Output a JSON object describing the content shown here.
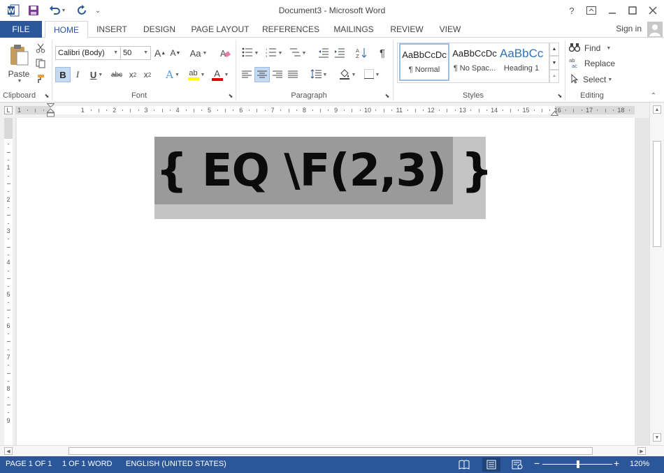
{
  "window": {
    "title": "Document3 - Microsoft Word",
    "help_label": "?"
  },
  "tabs": [
    {
      "label": "FILE"
    },
    {
      "label": "HOME"
    },
    {
      "label": "INSERT"
    },
    {
      "label": "DESIGN"
    },
    {
      "label": "PAGE LAYOUT"
    },
    {
      "label": "REFERENCES"
    },
    {
      "label": "MAILINGS"
    },
    {
      "label": "REVIEW"
    },
    {
      "label": "VIEW"
    }
  ],
  "account": {
    "signin_label": "Sign in"
  },
  "clipboard": {
    "paste_label": "Paste",
    "group_label": "Clipboard"
  },
  "font": {
    "family_value": "Calibri (Body)",
    "size_value": "50",
    "grow_label": "A",
    "shrink_label": "A",
    "case_label": "Aa",
    "bold_label": "B",
    "italic_label": "I",
    "underline_label": "U",
    "strike_label": "abc",
    "subscript_label": "x",
    "subscript_sub": "2",
    "superscript_label": "x",
    "superscript_sup": "2",
    "effects_label": "A",
    "highlight_label": "ab",
    "color_label": "A",
    "group_label": "Font",
    "colors": {
      "highlight": "#ffff00",
      "font_color": "#e00000"
    }
  },
  "paragraph": {
    "group_label": "Paragraph",
    "pilcrow_label": "¶"
  },
  "styles": {
    "items": [
      {
        "sample": "AaBbCcDc",
        "name": "¶ Normal"
      },
      {
        "sample": "AaBbCcDc",
        "name": "¶ No Spac..."
      },
      {
        "sample": "AaBbCc",
        "name": "Heading 1"
      }
    ],
    "group_label": "Styles",
    "heading_color": "#2e74b5"
  },
  "editing": {
    "find_label": "Find",
    "replace_label": "Replace",
    "select_label": "Select",
    "group_label": "Editing"
  },
  "ruler": {
    "tab_selector_label": "L",
    "ticks": [
      "1",
      "1",
      "2",
      "3",
      "4",
      "5",
      "6",
      "7",
      "8",
      "9",
      "10",
      "11",
      "12",
      "13",
      "14",
      "15",
      "16",
      "17",
      "18"
    ],
    "vticks": [
      "1",
      "2",
      "3",
      "4",
      "5",
      "6",
      "7",
      "8",
      "9"
    ]
  },
  "document": {
    "field_code": "{ EQ \\F(2,3) }"
  },
  "status": {
    "page": "PAGE 1 OF 1",
    "words": "1 OF 1 WORD",
    "language": "ENGLISH (UNITED STATES)",
    "zoom_level": "120%",
    "zoom_out_label": "−",
    "zoom_in_label": "+"
  },
  "theme": {
    "accent": "#2b579a"
  }
}
